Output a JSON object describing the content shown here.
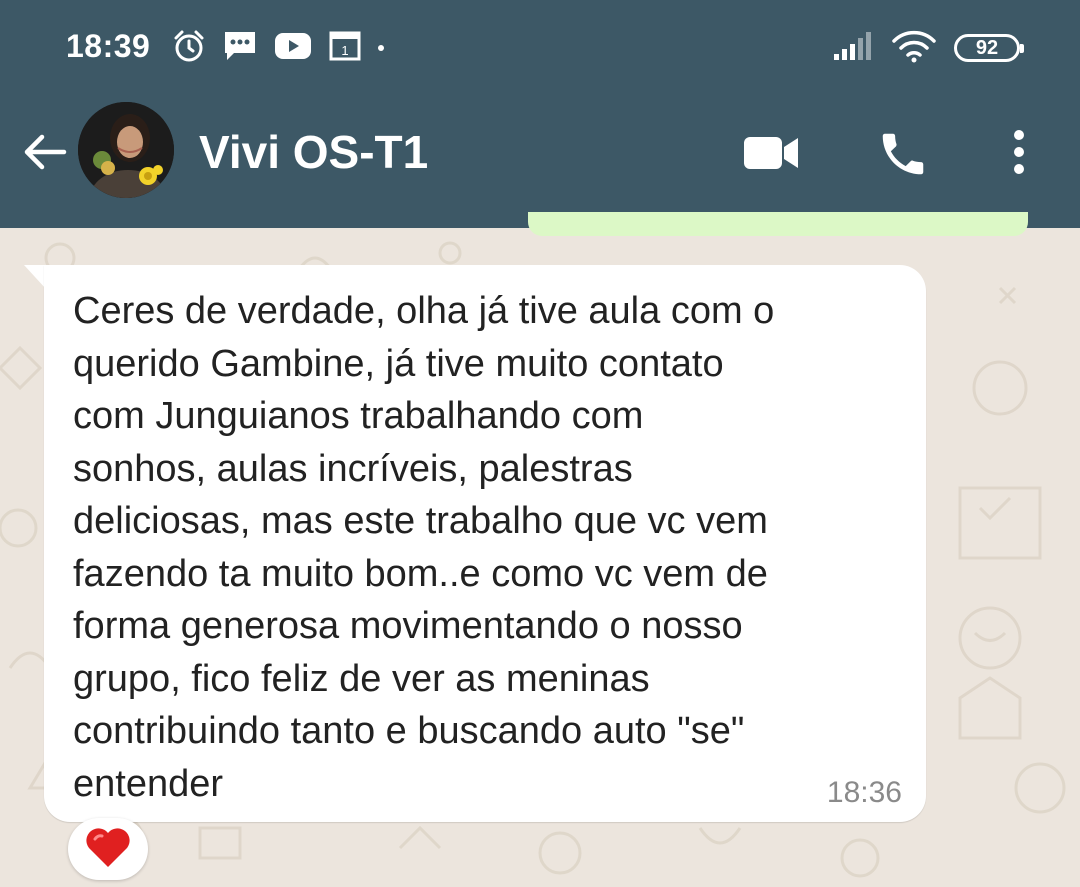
{
  "status_bar": {
    "time": "18:39",
    "battery": "92",
    "left_icons": [
      "alarm-icon",
      "message-icon",
      "youtube-icon",
      "calendar-icon",
      "dot-icon"
    ],
    "right_icons": [
      "signal-icon",
      "wifi-icon",
      "battery-icon"
    ]
  },
  "header": {
    "contact_name": "Vivi OS-T1",
    "icons": [
      "back-arrow-icon",
      "video-call-icon",
      "phone-icon",
      "more-options-icon"
    ]
  },
  "colors": {
    "header_bg": "#3D5866",
    "chat_bg": "#ECE5DD",
    "bubble_incoming": "#FFFFFF",
    "bubble_outgoing": "#DCF8C6",
    "text": "#222222",
    "timestamp": "#8A8A8A",
    "reaction_heart": "#E02020"
  },
  "message": {
    "text": "Ceres de verdade, olha já tive aula com o\nquerido Gambine, já tive muito contato\ncom Junguianos trabalhando com\nsonhos, aulas incríveis, palestras\ndeliciosas, mas este trabalho que vc vem\nfazendo ta muito bom..e como vc vem de\nforma generosa movimentando o nosso\ngrupo, fico feliz de ver as meninas\ncontribuindo tanto e buscando auto \"se\"\nentender",
    "time": "18:36",
    "reaction": "heart-icon"
  }
}
